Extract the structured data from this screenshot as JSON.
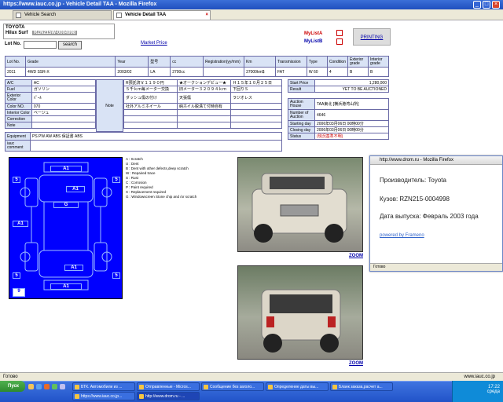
{
  "window": {
    "title": "https://www.iauc.co.jp - Vehicle Detail TAA - Mozilla Firefox"
  },
  "tabs": [
    {
      "label": "Vehicle Search"
    },
    {
      "label": "Vehicle Detail TAA"
    }
  ],
  "vehicle": {
    "make": "TOYOTA",
    "model": "Hilux Surf",
    "chassis": "RZN215W-0004998"
  },
  "lot_label": "Lot No.",
  "search_label": "search",
  "market_price_label": "Market Price",
  "mylist": {
    "a": "MyListA",
    "b": "MyListB"
  },
  "printing_label": "PRINTING",
  "main_table": {
    "headers": [
      "Lot No.",
      "Grade",
      "Year",
      "型号",
      "cc",
      "Registration(yy/mm)",
      "Km",
      "Transmission",
      "Type",
      "Condition",
      "Exterior grade",
      "Interior grade"
    ],
    "row": [
      "2011",
      "4WD SSR-X",
      "2003/02",
      "LA",
      "2700cc",
      "",
      "37000km$",
      "FAT",
      "W 60",
      "4",
      "B",
      "B"
    ]
  },
  "specs": [
    {
      "label": "A/C",
      "value": "AC"
    },
    {
      "label": "Fuel",
      "value": "ガソリン"
    },
    {
      "label": "Exterior Color",
      "value": "ﾊﾟｰﾙ"
    },
    {
      "label": "Color NO.",
      "value": "070"
    },
    {
      "label": "Interior Color",
      "value": "ベージュ"
    },
    {
      "label": "Correction",
      "value": ""
    },
    {
      "label": "Note",
      "value": ""
    }
  ],
  "note_label": "Note",
  "notes": [
    [
      "R預託済￥１１９０円",
      "★オークションデビュー★",
      "Ｈ１５年１０月２５日"
    ],
    [
      "５千ｋｍ毎メーター交換",
      "旧メーター３２０９４ｋｍ",
      "下回りＳ"
    ],
    [
      "ダッシュ傷の付け",
      "天張傷",
      "ラジオレス"
    ],
    [
      "社外アルミホイール",
      "純ホイル脱溝て付時自有",
      ""
    ]
  ],
  "equipment": {
    "label": "Equipment",
    "value": "PS PW AW ABS 保証書 ABS"
  },
  "iauc_comment": {
    "label": "iauc comment",
    "value": ""
  },
  "auction": [
    {
      "label": "Start Price",
      "value": "1,280,000"
    },
    {
      "label": "Result",
      "value": "YET TO BE AUCTIONED"
    },
    {
      "label": "Auction House",
      "value": "TAA東北 [横浜港湾山所]"
    },
    {
      "label": "Number of Auction",
      "value": "4646"
    },
    {
      "label": "Starting day",
      "value": "2006年03月06日 00時00分"
    },
    {
      "label": "Closing day",
      "value": "2006年03月06日 00時00分"
    },
    {
      "label": "Status",
      "value": "(現況基準不明)"
    }
  ],
  "diagram_zones": [
    "A1",
    "5",
    "5",
    "A1",
    "G",
    "A1",
    "A1",
    "5",
    "5",
    "A1",
    "9"
  ],
  "legend": [
    "A : Scratch",
    "U : Dent",
    "B : Dent with other defects,deep scratch",
    "W : Repaired trace",
    "S : Rust",
    "C : Corrosion",
    "P : Paint required",
    "X : Replacement required",
    "G : Windowscreen Stone chip and /or scratch"
  ],
  "zoom_label": "ZOOM",
  "popup": {
    "title": "http://www.drom.ru - Mozilla Firefox",
    "manufacturer": "Производитель: Toyota",
    "body": "Кузов: RZN215-0004998",
    "release": "Дата выпуска: Февраль 2003 года",
    "powered": "powered by Frameno",
    "status": "Готово"
  },
  "statusbar": {
    "left": "Готово",
    "right": "www.iauc.co.jp"
  },
  "taskbar": {
    "start": "Пуск",
    "tasks": [
      "БТК. Автомобили из ...",
      "Отправленные - Micros...",
      "Сообщение без заголо...",
      "Определение даты вы...",
      "Бланк заказа,расчет а...",
      "https://www.iauc.co.jp...",
      "http://www.drom.ru - ..."
    ],
    "clock": "17:22",
    "day": "среда"
  },
  "colors": {
    "diagram": "#0000ff",
    "titlebar": "#2a5fcf",
    "taskbar": "#2b5fd6",
    "header_cell": "#d9e3f5"
  }
}
